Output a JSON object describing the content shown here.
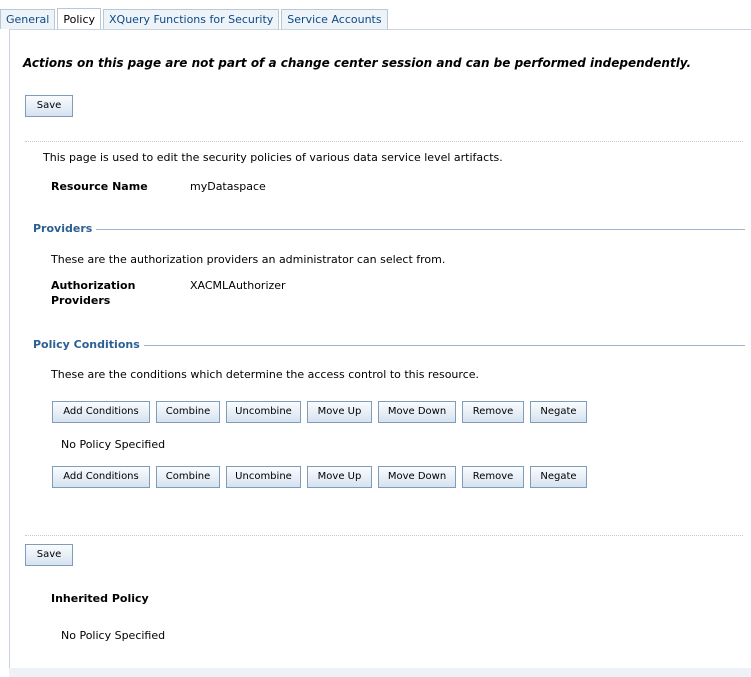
{
  "tabs": [
    "General",
    "Policy",
    "XQuery Functions for Security",
    "Service Accounts"
  ],
  "notice": "Actions on this page are not part of a change center session and can be performed independently.",
  "save_label": "Save",
  "description": "This page is used to edit the security policies of various data service level artifacts.",
  "resource": {
    "label": "Resource Name",
    "value": "myDataspace"
  },
  "providers": {
    "heading": "Providers",
    "description": "These are the authorization providers an administrator can select from.",
    "label_line1": "Authorization",
    "label_line2": "Providers",
    "value": "XACMLAuthorizer"
  },
  "policy_conditions": {
    "heading": "Policy Conditions",
    "description": "These are the conditions which determine the access control to this resource.",
    "buttons": [
      "Add Conditions",
      "Combine",
      "Uncombine",
      "Move Up",
      "Move Down",
      "Remove",
      "Negate"
    ],
    "no_policy": "No Policy Specified"
  },
  "inherited": {
    "heading": "Inherited Policy",
    "no_policy": "No Policy Specified"
  }
}
